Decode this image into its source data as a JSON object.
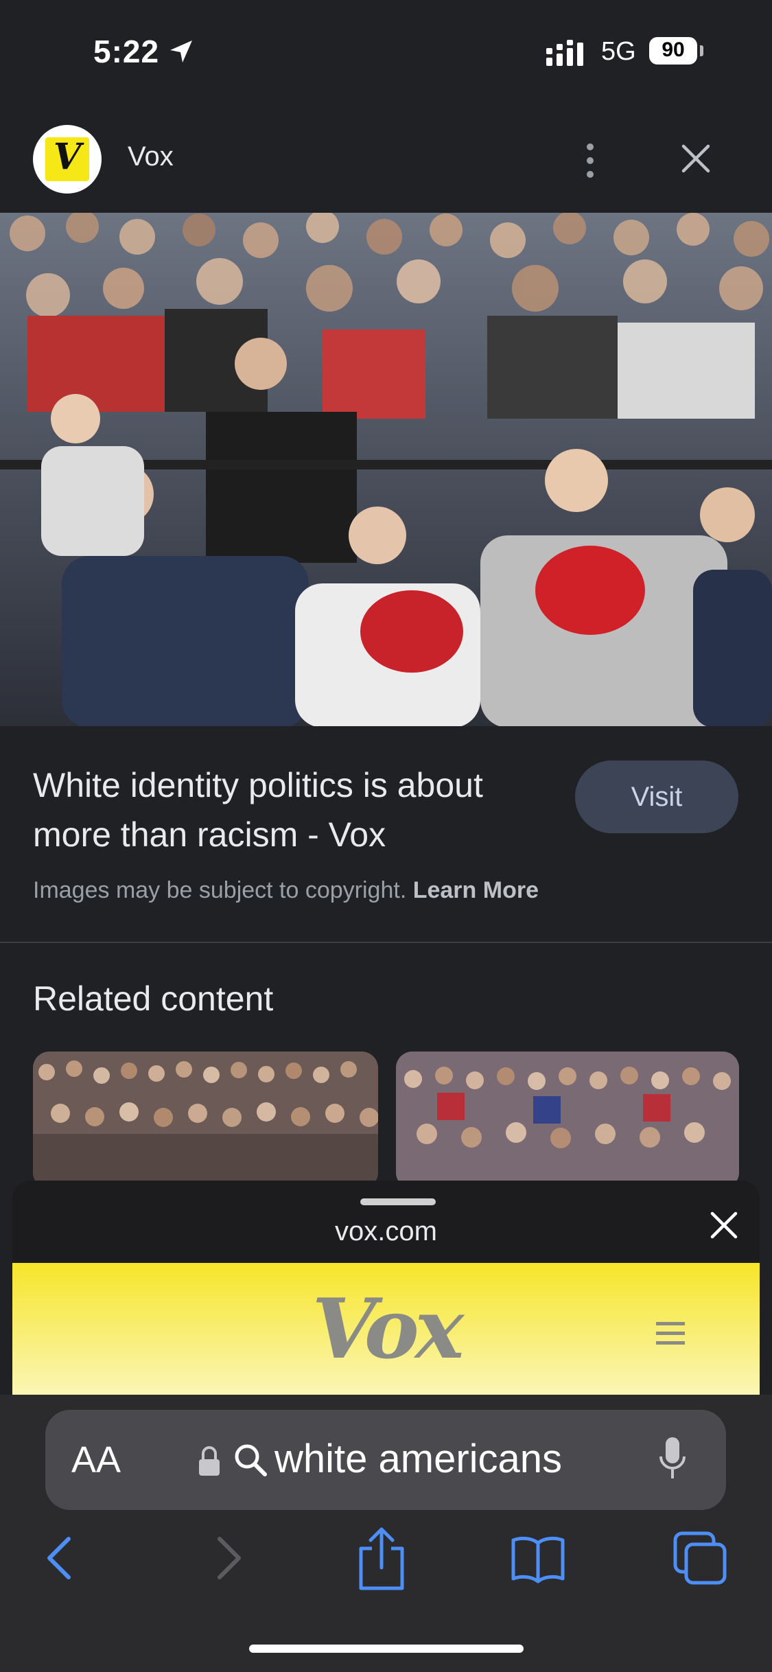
{
  "status_bar": {
    "time": "5:22",
    "network": "5G",
    "battery": "90"
  },
  "header": {
    "site_name": "Vox",
    "logo_letter": "V"
  },
  "result": {
    "title": "White identity politics is about more than racism - Vox",
    "visit_label": "Visit",
    "copyright_text": "Images may be subject to copyright.",
    "learn_more": "Learn More"
  },
  "related": {
    "title": "Related content"
  },
  "sheet": {
    "domain": "vox.com",
    "brand": "Vox"
  },
  "browser": {
    "text_size_label": "AA",
    "search_query": "white americans"
  },
  "colors": {
    "background": "#202124",
    "brand_yellow": "#f6e717",
    "accent_blue": "#4e8ef7"
  },
  "icons": [
    "location-arrow-icon",
    "signal-icon",
    "battery-icon",
    "more-icon",
    "close-icon",
    "lock-icon",
    "search-icon",
    "mic-icon",
    "back-icon",
    "forward-icon",
    "share-icon",
    "bookmarks-icon",
    "tabs-icon",
    "hamburger-icon"
  ]
}
